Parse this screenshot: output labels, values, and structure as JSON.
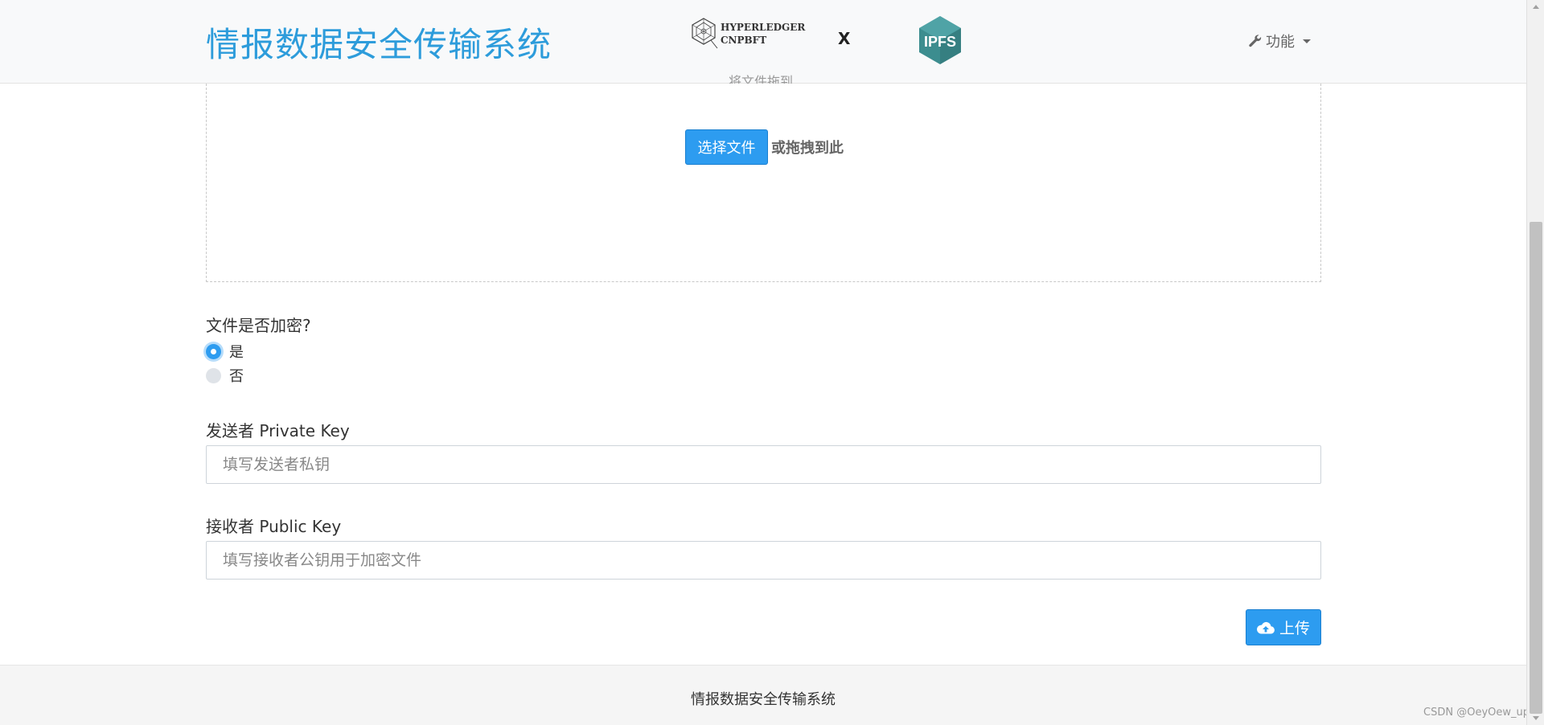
{
  "navbar": {
    "brand": "情报数据安全传输系统",
    "hyperledger_line1": "HYPERLEDGER",
    "hyperledger_line2": "CNPBFT",
    "separator": "X",
    "ipfs_label": "IPFS",
    "func_menu_label": "功能"
  },
  "dropzone": {
    "clipped_hint": "将文件拖到",
    "choose_file_label": "选择文件",
    "drag_hint": "或拖拽到此"
  },
  "form": {
    "encrypt_question": "文件是否加密?",
    "radio_yes": "是",
    "radio_no": "否",
    "sender_label": "发送者 Private Key",
    "sender_placeholder": "填写发送者私钥",
    "receiver_label": "接收者 Public Key",
    "receiver_placeholder": "填写接收者公钥用于加密文件",
    "upload_label": "上传"
  },
  "footer": {
    "text": "情报数据安全传输系统",
    "watermark": "CSDN @OeyOew_up"
  },
  "colors": {
    "brand": "#2d9cdb",
    "primary_button": "#2d9cf0",
    "ipfs_teal": "#3c8d8f"
  }
}
